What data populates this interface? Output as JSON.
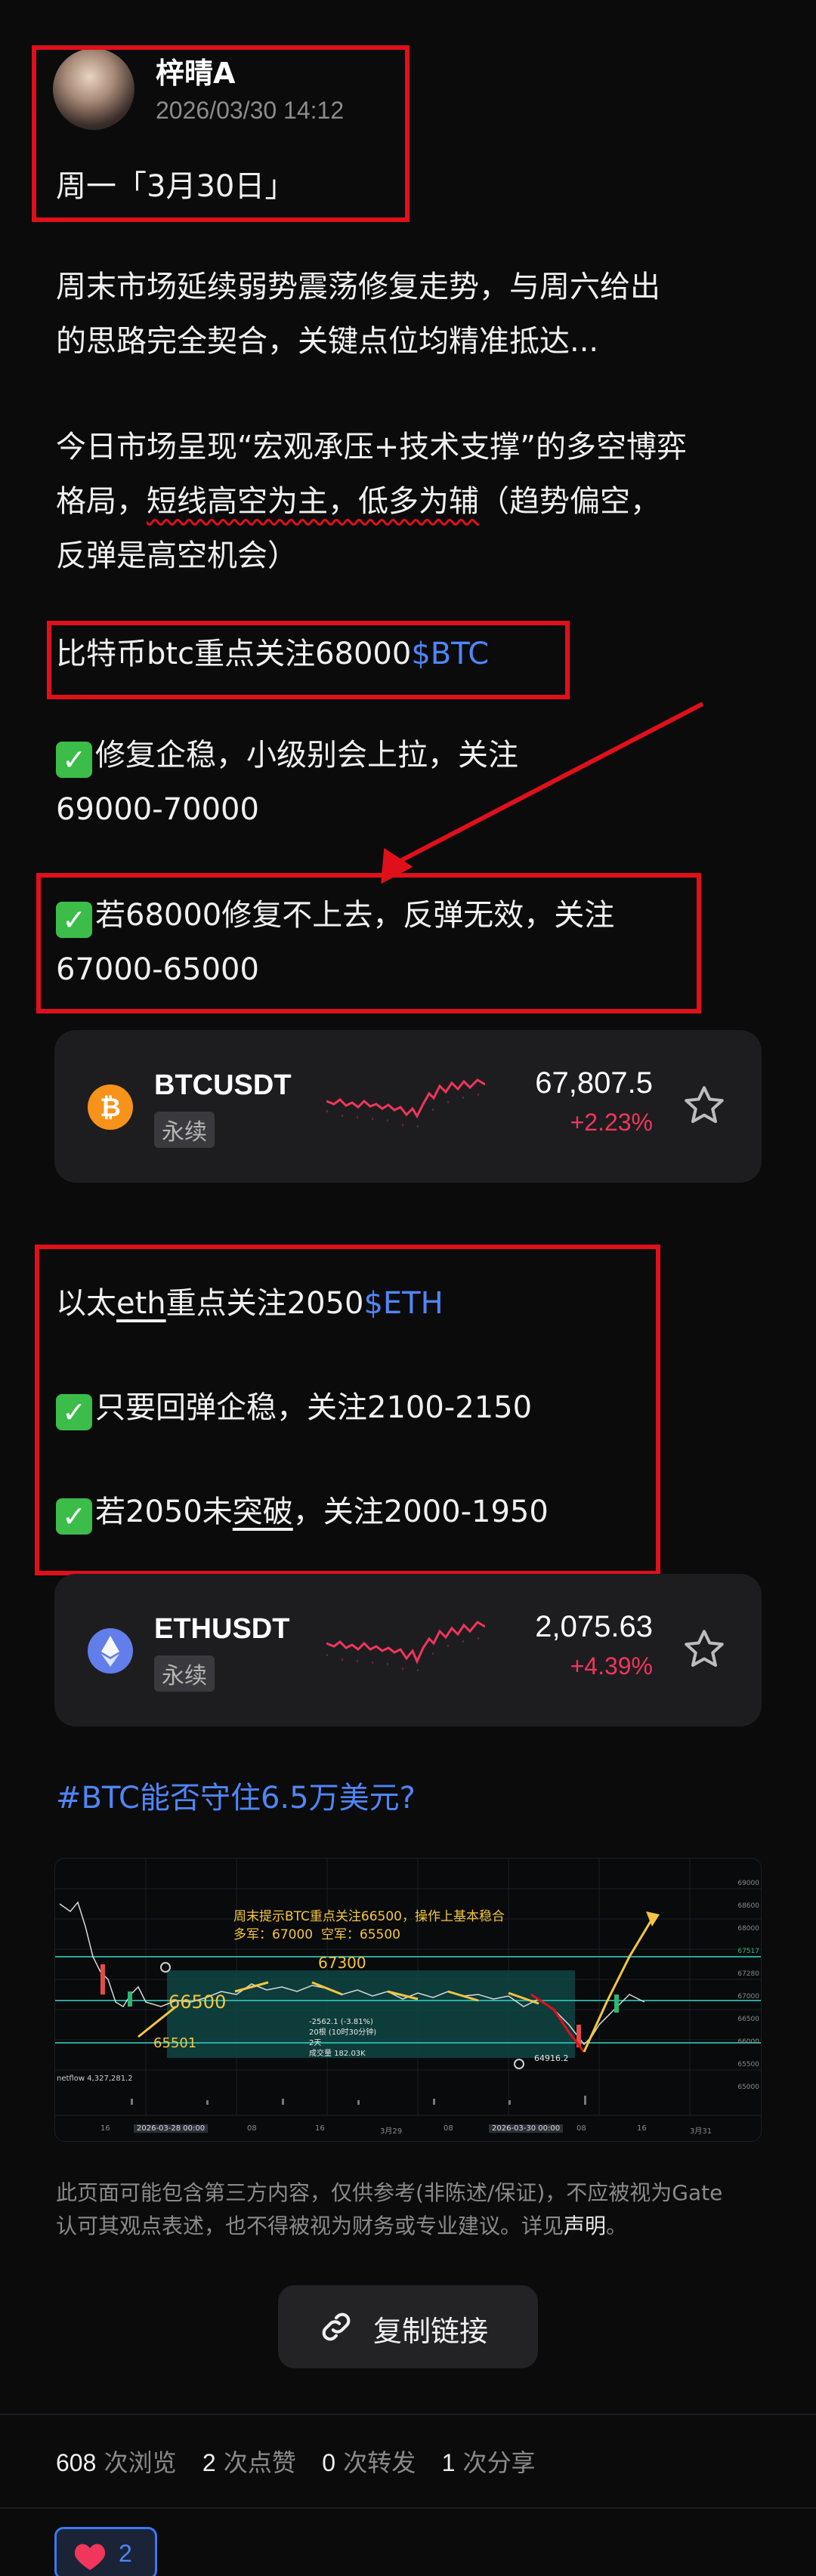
{
  "post": {
    "author": "梓晴A",
    "timestamp": "2026/03/30 14:12",
    "date_line": "周一「3月30日」",
    "intro_1a": "周末市场延续弱势震荡修复走势，与周六给出",
    "intro_1b": "的思路完全契合，关键点位均精准抵达...",
    "intro_2a": "今日市场呈现“宏观承压+技术支撑”的多空博弈",
    "intro_2b_pre": "格局，",
    "intro_2b_wavy": "短线高空为主，低多为辅",
    "intro_2b_post": "（趋势偏空，",
    "intro_2c": "反弹是高空机会）",
    "btc_focus": "比特币btc重点关注68000",
    "btc_tag": "$BTC",
    "btc_point1a": "修复企稳，小级别会上拉，关注",
    "btc_point1b": "69000-70000",
    "btc_point2a": "若68000修复不上去，反弹无效，关注",
    "btc_point2b": "67000-65000",
    "eth_focus_pre": "以太",
    "eth_focus_u": "eth",
    "eth_focus_post": "重点关注2050",
    "eth_tag": "$ETH",
    "eth_point1": "只要回弹企稳，关注2100-2150",
    "eth_point2_pre": "若2050未",
    "eth_point2_u": "突破",
    "eth_point2_post": "，关注2000-1950",
    "hashtag": "#BTC能否守住6.5万美元?",
    "disclaimer_a": "此页面可能包含第三方内容，仅供参考(非陈述/保证)，不应被视为Gate",
    "disclaimer_b": "认可其观点表述，也不得被视为财务或专业建议。详见",
    "disclaimer_link": "声明",
    "disclaimer_end": "。"
  },
  "tickers": [
    {
      "pair": "BTCUSDT",
      "tag": "永续",
      "price": "67,807.5",
      "change": "+2.23%",
      "coin_icon": "bitcoin-icon",
      "coin_color": "#f7931a"
    },
    {
      "pair": "ETHUSDT",
      "tag": "永续",
      "price": "2,075.63",
      "change": "+4.39%",
      "coin_icon": "ethereum-icon",
      "coin_color": "#627eea"
    }
  ],
  "chart_image": {
    "headline": "周末提示BTC重点关注66500，操作上基本稳合",
    "subline": "多军：67000  空军：65500",
    "labels": [
      "67300",
      "66500",
      "65501",
      "64916.2"
    ],
    "stats": [
      "-2562.1 (-3.81%)",
      "20根 (10时30分钟)",
      "2天",
      "成交量 182.03K"
    ],
    "indicator": "netflow 4,327,281.2",
    "time_labels": [
      "16",
      "2026-03-28 00:00",
      "08",
      "16",
      "3月29",
      "08",
      "16",
      "2026-03-30 00:00",
      "08",
      "16",
      "3月31"
    ],
    "price_axis": [
      "69000",
      "68600",
      "68000",
      "67517",
      "67280",
      "67000",
      "66500",
      "66000",
      "65500",
      "65000"
    ]
  },
  "actions": {
    "copy_link": "复制链接"
  },
  "stats": {
    "views": "608",
    "views_label": "次浏览",
    "likes": "2",
    "likes_label": "次点赞",
    "reposts": "0",
    "reposts_label": "次转发",
    "shares": "1",
    "shares_label": "次分享"
  },
  "reaction": {
    "count": "2"
  },
  "colors": {
    "accent_blue": "#4f86f7",
    "up_red": "#f0365a",
    "annotation_red": "#e0101a"
  }
}
